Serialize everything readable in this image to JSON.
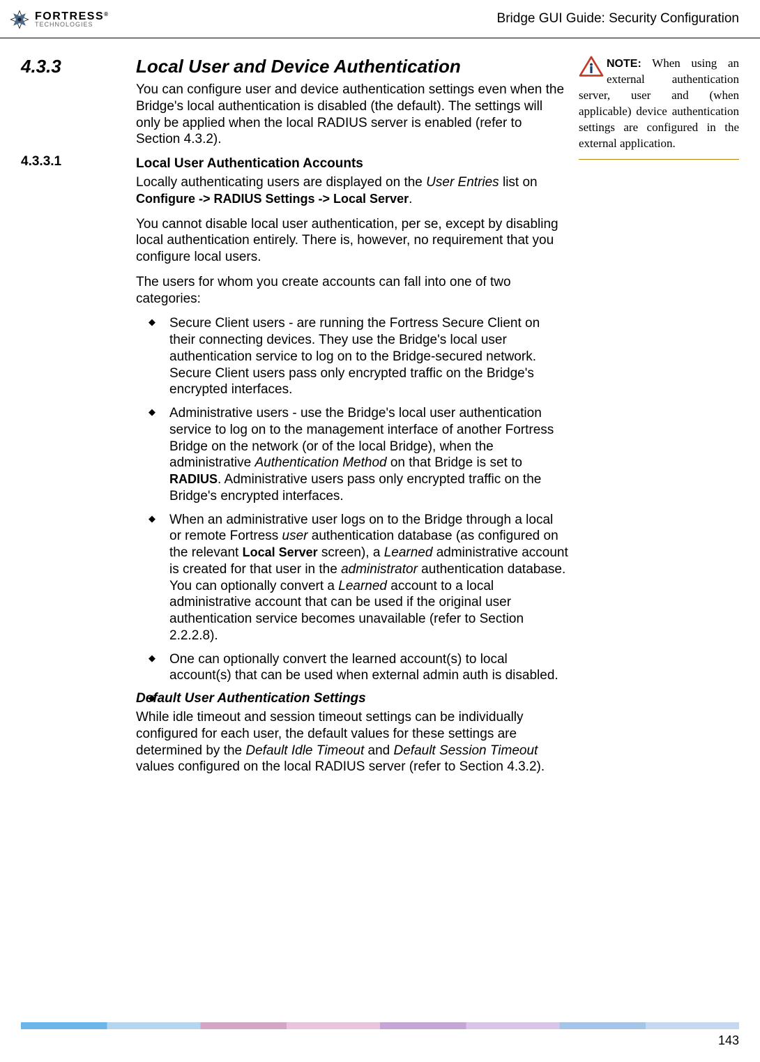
{
  "header": {
    "logo_main": "FORTRESS",
    "logo_sub": "TECHNOLOGIES",
    "logo_tm": "®",
    "doc_title": "Bridge GUI Guide: Security Configuration"
  },
  "section": {
    "num": "4.3.3",
    "title": "Local User and Device Authentication",
    "intro": "You can configure user and device authentication settings even when the Bridge's local authentication is disabled (the default). The settings will only be applied when the local RADIUS server is enabled (refer to Section 4.3.2)."
  },
  "subsection": {
    "num": "4.3.3.1",
    "title": "Local User Authentication Accounts",
    "p1_a": "Locally authenticating users are displayed on the ",
    "p1_b": "User Entries",
    "p1_c": " list on ",
    "p1_d": "Configure -> RADIUS Settings -> Local Server",
    "p1_e": ".",
    "p2": "You cannot disable local user authentication, per se, except by disabling local authentication entirely. There is, however, no requirement that you configure local users.",
    "p3": "The users for whom you create accounts can fall into one of two categories:",
    "bullets": [
      {
        "text": "Secure Client users - are running the Fortress Secure Client on their connecting devices. They use the Bridge's local user authentication service to log on to the Bridge-secured network. Secure Client users pass only encrypted traffic on the Bridge's encrypted interfaces."
      },
      {
        "pre": "Administrative users - use the Bridge's local user authentication service to log on to the management interface of another Fortress Bridge on the network (or of the local Bridge), when the administrative ",
        "i1": "Authentication Method",
        "mid1": " on that Bridge is set to ",
        "b1": "RADIUS",
        "post": ". Administrative users pass only encrypted traffic on the Bridge's encrypted interfaces."
      },
      {
        "pre": "When an administrative user logs on to the Bridge through a local or remote Fortress ",
        "i1": "user",
        "mid1": " authentication database (as configured on the relevant ",
        "b1": "Local Server",
        "mid2": " screen), a ",
        "i2": "Learned",
        "mid3": " administrative account is created for that user in the ",
        "i3": "administrator",
        "mid4": " authentication database. You can optionally convert a ",
        "i4": "Learned",
        "post": " account to a local administrative account that can be used if the original user authentication service becomes unavailable (refer to Section 2.2.2.8)."
      },
      {
        "text": "One can optionally convert the learned account(s) to local account(s) that can be used when external admin auth is disabled."
      },
      {
        "text": ""
      }
    ],
    "h2": "Default User Authentication Settings",
    "p4_a": "While idle timeout and session timeout settings can be individually configured for each user, the default values for these settings are determined by the ",
    "p4_b": "Default Idle Timeout",
    "p4_c": " and ",
    "p4_d": "Default Session Timeout",
    "p4_e": " values configured on the local RADIUS server (refer to Section 4.3.2)."
  },
  "note": {
    "label": "NOTE:",
    "text": " When using an external authentication server, user and (when applicable) device authentication settings are configured in the external application."
  },
  "footer": {
    "page_num": "143"
  }
}
